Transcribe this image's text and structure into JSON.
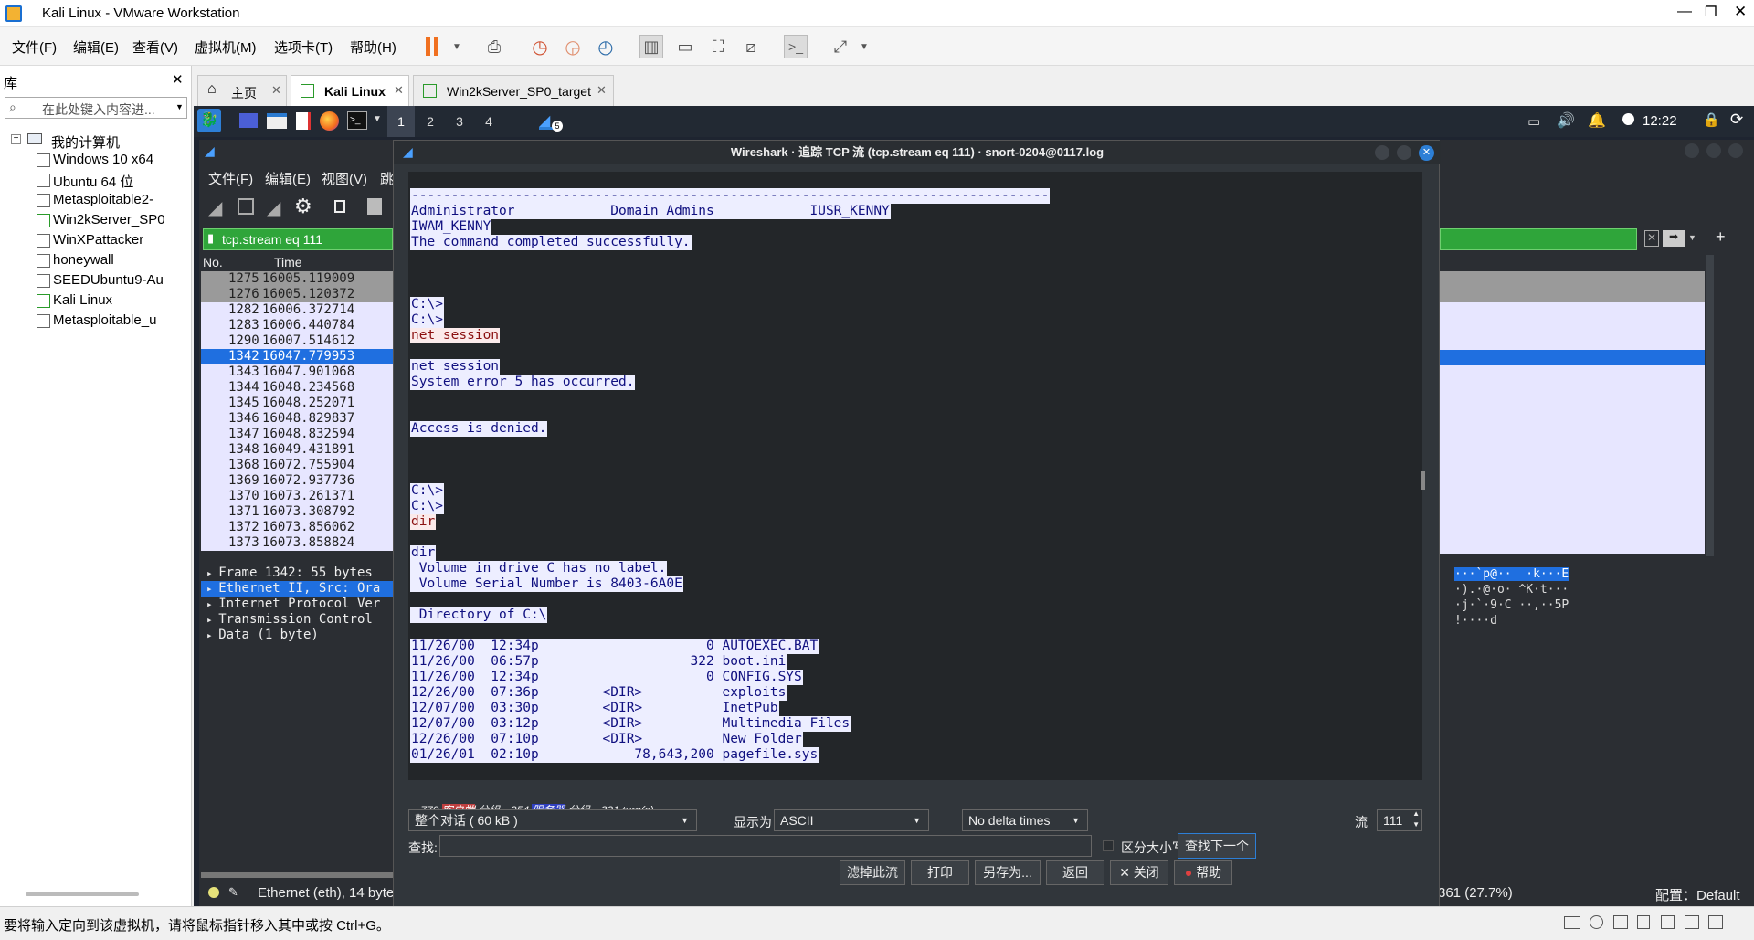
{
  "window": {
    "title": "Kali Linux - VMware Workstation"
  },
  "menu": [
    "文件(F)",
    "编辑(E)",
    "查看(V)",
    "虚拟机(M)",
    "选项卡(T)",
    "帮助(H)"
  ],
  "library": {
    "title": "库",
    "search_placeholder": "在此处键入内容进...",
    "root": "我的计算机",
    "vms": [
      "Windows 10 x64",
      "Ubuntu 64 位",
      "Metasploitable2-",
      "Win2kServer_SP0",
      "WinXPattacker",
      "honeywall",
      "SEEDUbuntu9-Au",
      "Kali Linux",
      "Metasploitable_u"
    ]
  },
  "tabs": [
    "主页",
    "Kali Linux",
    "Win2kServer_SP0_target"
  ],
  "kali_panel": {
    "workspaces": [
      "1",
      "2",
      "3",
      "4"
    ],
    "badge": "5",
    "clock": "12:22"
  },
  "wireshark_main": {
    "menu": [
      "文件(F)",
      "编辑(E)",
      "视图(V)",
      "跳"
    ],
    "filter": "tcp.stream eq 111",
    "columns": [
      "No.",
      "Time"
    ],
    "packets": [
      {
        "no": "1275",
        "time": "16005.119009"
      },
      {
        "no": "1276",
        "time": "16005.120372"
      },
      {
        "no": "1282",
        "time": "16006.372714"
      },
      {
        "no": "1283",
        "time": "16006.440784"
      },
      {
        "no": "1290",
        "time": "16007.514612"
      },
      {
        "no": "1342",
        "time": "16047.779953"
      },
      {
        "no": "1343",
        "time": "16047.901068"
      },
      {
        "no": "1344",
        "time": "16048.234568"
      },
      {
        "no": "1345",
        "time": "16048.252071"
      },
      {
        "no": "1346",
        "time": "16048.829837"
      },
      {
        "no": "1347",
        "time": "16048.832594"
      },
      {
        "no": "1348",
        "time": "16049.431891"
      },
      {
        "no": "1368",
        "time": "16072.755904"
      },
      {
        "no": "1369",
        "time": "16072.937736"
      },
      {
        "no": "1370",
        "time": "16073.261371"
      },
      {
        "no": "1371",
        "time": "16073.308792"
      },
      {
        "no": "1372",
        "time": "16073.856062"
      },
      {
        "no": "1373",
        "time": "16073.858824"
      }
    ],
    "details": [
      "Frame 1342: 55 bytes",
      "Ethernet II, Src: Ora",
      "Internet Protocol Ver",
      "Transmission Control",
      "Data (1 byte)"
    ],
    "hex": [
      "···`p@··  ·k···E",
      "·).·@·o· ^K·t···",
      "·j·`·9·C ··,··5P",
      "!····d"
    ],
    "status": "Ethernet (eth), 14 byte",
    "status_right": "361 (27.7%)",
    "profile": "配置：Default"
  },
  "dialog": {
    "title": "Wireshark · 追踪 TCP 流 (tcp.stream eq 111) · snort-0204@0117.log",
    "lines": [
      {
        "t": "--------------------------------------------------------------------------------",
        "k": "srv"
      },
      {
        "t": "Administrator            Domain Admins            IUSR_KENNY",
        "k": "srv"
      },
      {
        "t": "IWAM_KENNY",
        "k": "srv"
      },
      {
        "t": "The command completed successfully.",
        "k": "srv"
      },
      {
        "t": "",
        "k": ""
      },
      {
        "t": "",
        "k": ""
      },
      {
        "t": "",
        "k": ""
      },
      {
        "t": "C:\\>",
        "k": "srv"
      },
      {
        "t": "C:\\>",
        "k": "srv"
      },
      {
        "t": "net session",
        "k": "cli"
      },
      {
        "t": "",
        "k": ""
      },
      {
        "t": "net session",
        "k": "srv"
      },
      {
        "t": "System error 5 has occurred.",
        "k": "srv"
      },
      {
        "t": "",
        "k": ""
      },
      {
        "t": "",
        "k": ""
      },
      {
        "t": "Access is denied.",
        "k": "srv"
      },
      {
        "t": "",
        "k": ""
      },
      {
        "t": "",
        "k": ""
      },
      {
        "t": "",
        "k": ""
      },
      {
        "t": "C:\\>",
        "k": "srv"
      },
      {
        "t": "C:\\>",
        "k": "srv"
      },
      {
        "t": "dir",
        "k": "cli"
      },
      {
        "t": "",
        "k": ""
      },
      {
        "t": "dir",
        "k": "srv"
      },
      {
        "t": " Volume in drive C has no label.",
        "k": "srv"
      },
      {
        "t": " Volume Serial Number is 8403-6A0E",
        "k": "srv"
      },
      {
        "t": "",
        "k": ""
      },
      {
        "t": " Directory of C:\\",
        "k": "srv"
      },
      {
        "t": "",
        "k": ""
      },
      {
        "t": "11/26/00  12:34p                     0 AUTOEXEC.BAT",
        "k": "srv"
      },
      {
        "t": "11/26/00  06:57p                   322 boot.ini",
        "k": "srv"
      },
      {
        "t": "11/26/00  12:34p                     0 CONFIG.SYS",
        "k": "srv"
      },
      {
        "t": "12/26/00  07:36p        <DIR>          exploits",
        "k": "srv"
      },
      {
        "t": "12/07/00  03:30p        <DIR>          InetPub",
        "k": "srv"
      },
      {
        "t": "12/07/00  03:12p        <DIR>          Multimedia Files",
        "k": "srv"
      },
      {
        "t": "12/26/00  07:10p        <DIR>          New Folder",
        "k": "srv"
      },
      {
        "t": "01/26/01  02:10p            78,643,200 pagefile.sys",
        "k": "srv"
      }
    ],
    "summary": {
      "a": "779 ",
      "client": "客户端",
      "b": " 分组，254 ",
      "server": "服务器",
      "c": " 分组，321 turn(s)."
    },
    "conversation": "整个对话 ( 60 kB )",
    "show_as_label": "显示为",
    "show_as": "ASCII",
    "delta": "No delta times",
    "stream_label": "流",
    "stream_no": "111",
    "find_label": "查找:",
    "case_label": "区分大小写",
    "find_next": "查找下一个(N)",
    "buttons": [
      "滤掉此流",
      "打印",
      "另存为...",
      "返回",
      "✕ 关闭",
      "帮助"
    ]
  },
  "statusbar": "要将输入定向到该虚拟机，请将鼠标指针移入其中或按 Ctrl+G。"
}
